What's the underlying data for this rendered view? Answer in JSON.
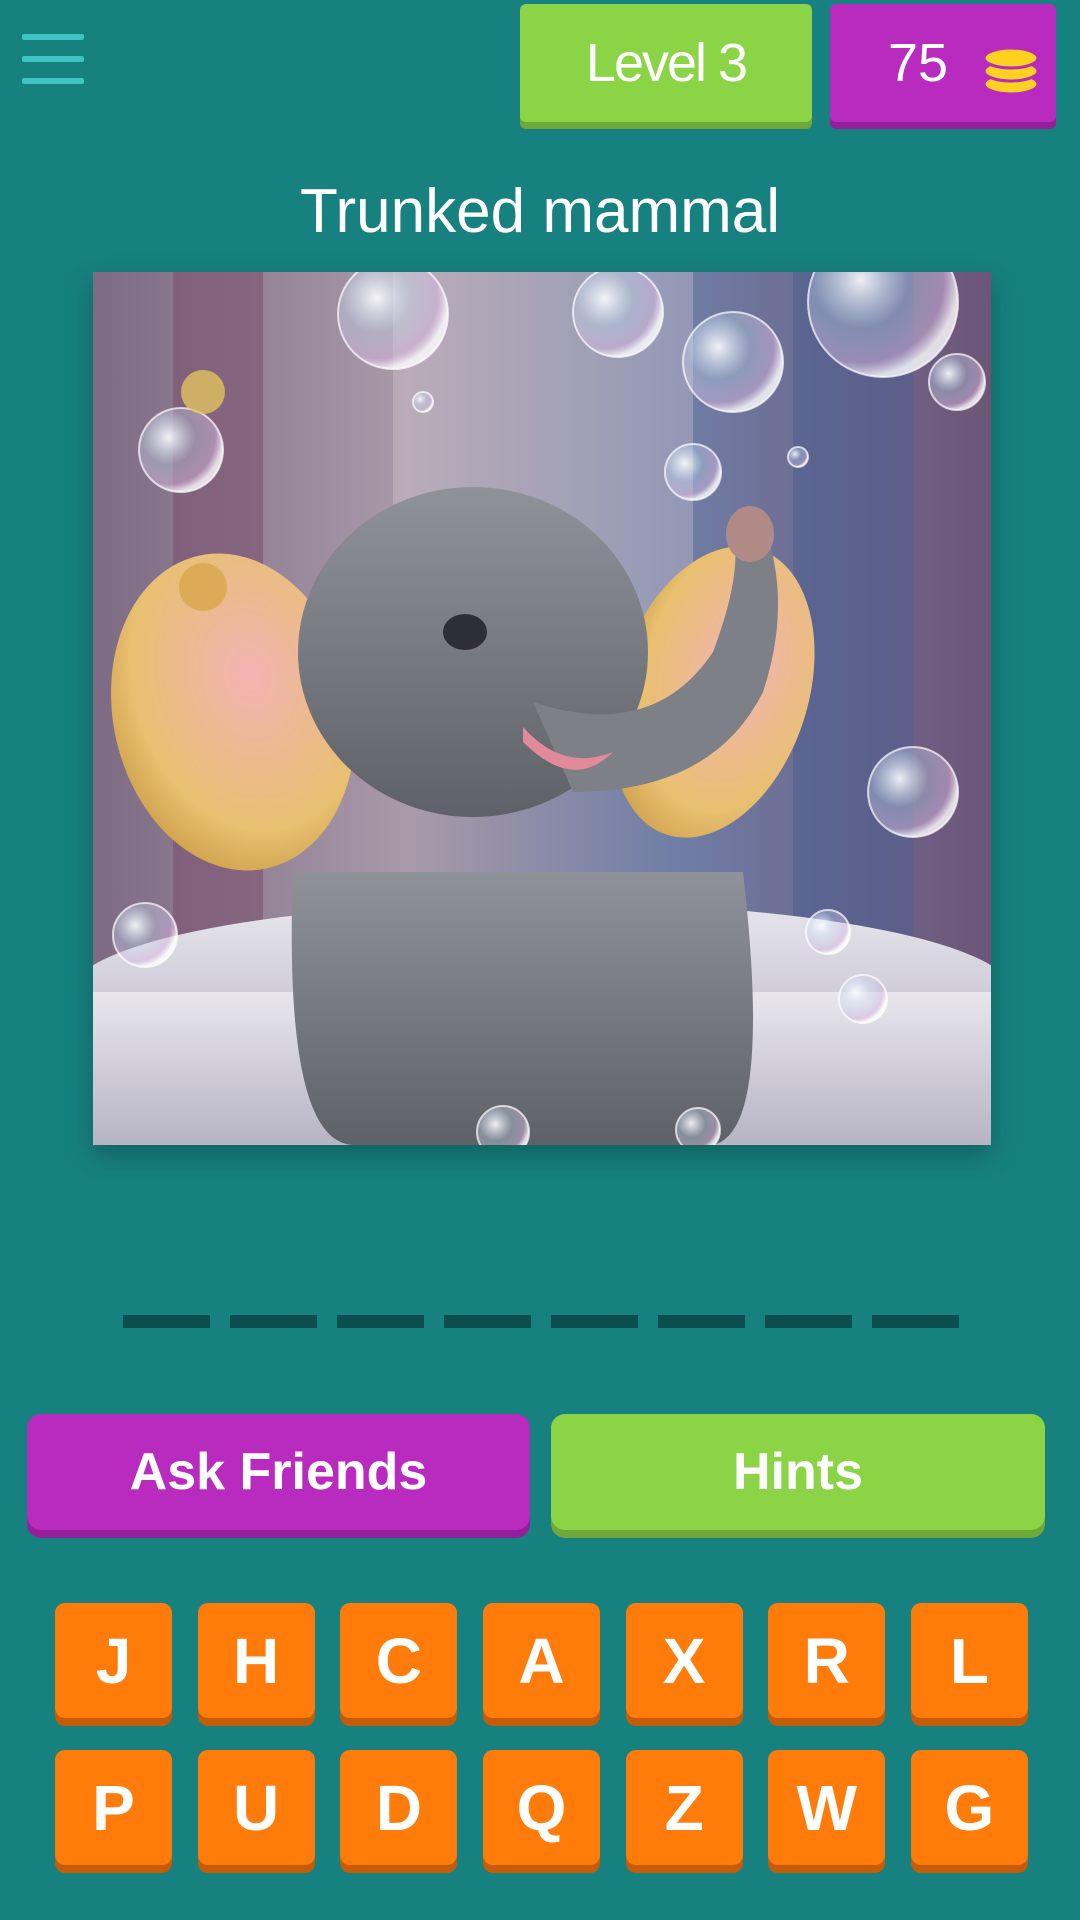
{
  "header": {
    "menu_icon": "hamburger-menu-icon",
    "level_label": "Level 3",
    "coins": "75",
    "coin_icon": "coin-stack-icon",
    "coin_color": "#ffd21f"
  },
  "puzzle": {
    "clue": "Trunked mammal",
    "answer_slot_count": 8
  },
  "actions": {
    "ask_friends_label": "Ask Friends",
    "hints_label": "Hints"
  },
  "keyboard": {
    "rows": [
      [
        "J",
        "H",
        "C",
        "A",
        "X",
        "R",
        "L"
      ],
      [
        "P",
        "U",
        "D",
        "Q",
        "Z",
        "W",
        "G"
      ]
    ]
  },
  "colors": {
    "background": "#17817f",
    "green_accent": "#8bd446",
    "purple_accent": "#b92bbf",
    "key_orange": "#ff7b0a",
    "slot_dark": "#0b4e4d"
  }
}
